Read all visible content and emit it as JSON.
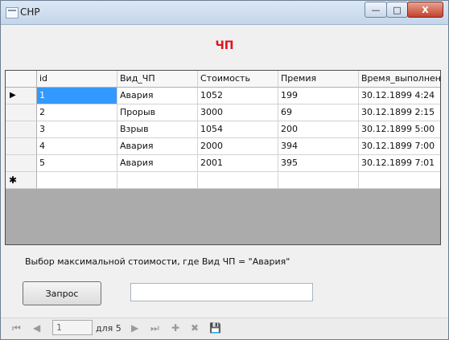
{
  "window": {
    "title": "CHP",
    "minimize_glyph": "—",
    "maximize_glyph": "□",
    "close_glyph": "X"
  },
  "heading": "ЧП",
  "grid": {
    "columns": [
      "id",
      "Вид_ЧП",
      "Стоимость",
      "Премия",
      "Время_выполнени"
    ],
    "rows": [
      [
        "1",
        "Авария",
        "1052",
        "199",
        "30.12.1899 4:24"
      ],
      [
        "2",
        "Прорыв",
        "3000",
        "69",
        "30.12.1899 2:15"
      ],
      [
        "3",
        "Взрыв",
        "1054",
        "200",
        "30.12.1899 5:00"
      ],
      [
        "4",
        "Авария",
        "2000",
        "394",
        "30.12.1899 7:00"
      ],
      [
        "5",
        "Авария",
        "2001",
        "395",
        "30.12.1899 7:01"
      ]
    ],
    "current_row_marker": "▶",
    "new_row_marker": "✱"
  },
  "query_label": "Выбор максимальной стоимости, где Вид ЧП = \"Авария\"",
  "query_button": "Запрос",
  "result_value": "",
  "navigator": {
    "position": "1",
    "count_label": "для 5",
    "icons": [
      "move-first-icon",
      "move-previous-icon",
      "move-next-icon",
      "move-last-icon",
      "add-icon",
      "delete-icon",
      "save-icon"
    ]
  }
}
